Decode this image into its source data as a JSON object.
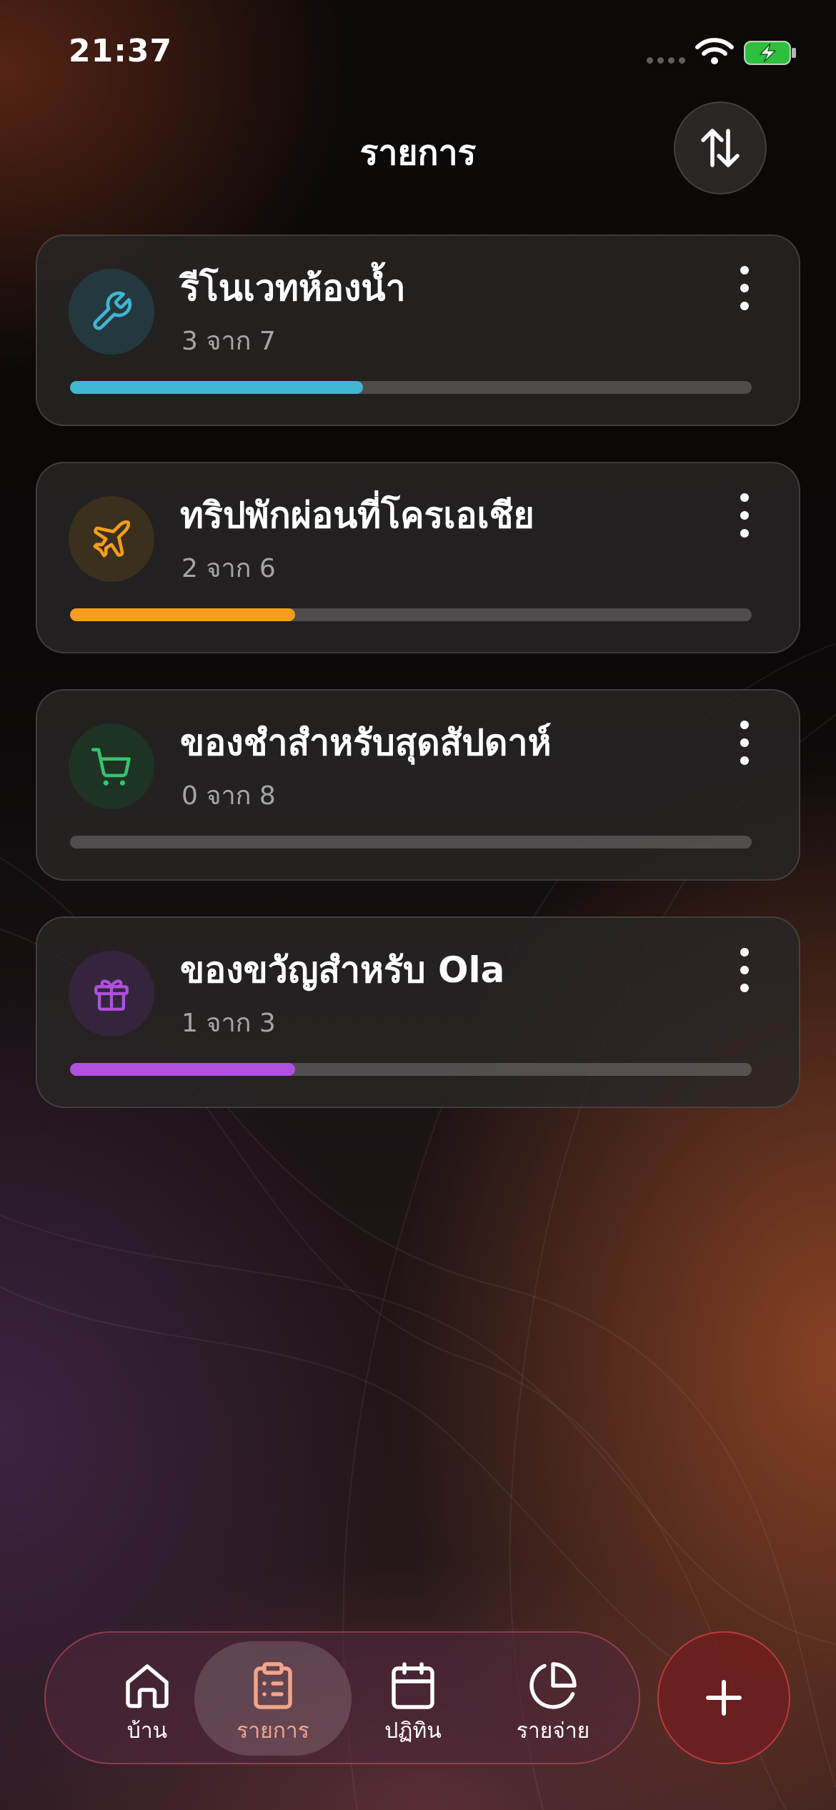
{
  "status_bar": {
    "time": "21:37"
  },
  "header": {
    "title": "รายการ"
  },
  "lists": [
    {
      "title": "รีโนเวทห้องน้ำ",
      "progress_text": "3 จาก 7",
      "done": 3,
      "total": 7,
      "progress": 0.43,
      "icon": "wrench-icon",
      "color": "#3fb6d3",
      "icon_bg": "#24393f"
    },
    {
      "title": "ทริปพักผ่อนที่โครเอเชีย",
      "progress_text": "2 จาก 6",
      "done": 2,
      "total": 6,
      "progress": 0.33,
      "icon": "airplane-icon",
      "color": "#f59e1b",
      "icon_bg": "#3b2f1e"
    },
    {
      "title": "ของชำสำหรับสุดสัปดาห์",
      "progress_text": "0 จาก 8",
      "done": 0,
      "total": 8,
      "progress": 0.0,
      "icon": "cart-icon",
      "color": "#35c46b",
      "icon_bg": "#1f3325"
    },
    {
      "title": "ของขวัญสำหรับ Ola",
      "progress_text": "1 จาก 3",
      "done": 1,
      "total": 3,
      "progress": 0.33,
      "icon": "gift-icon",
      "color": "#b04fe0",
      "icon_bg": "#35253c"
    }
  ],
  "tabs": [
    {
      "label": "บ้าน",
      "icon": "home-icon",
      "active": false
    },
    {
      "label": "รายการ",
      "icon": "clipboard-list-icon",
      "active": true
    },
    {
      "label": "ปฏิทิน",
      "icon": "calendar-icon",
      "active": false
    },
    {
      "label": "รายจ่าย",
      "icon": "pie-chart-icon",
      "active": false
    }
  ],
  "colors": {
    "active_tab": "#f2a58c",
    "accent": "#e0534f"
  }
}
